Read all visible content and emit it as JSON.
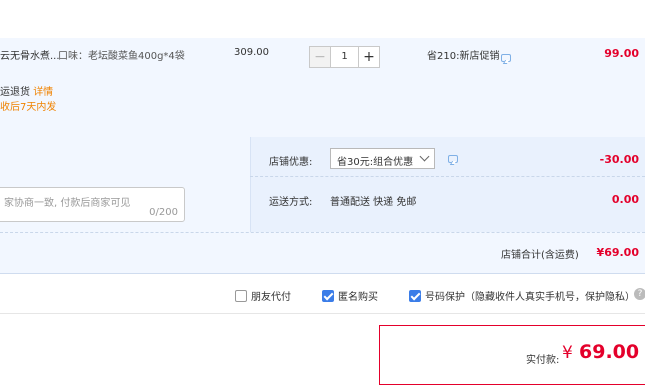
{
  "item": {
    "title": "云无骨水煮...",
    "sku": "口味：老坛酸菜鱼400g*4袋",
    "price": "309.00",
    "quantity": "1",
    "minus": "−",
    "plus": "+",
    "promo": "省210:新店促销",
    "total": "99.00",
    "service_text": "运退货",
    "service_link": "详情",
    "service_note": "收后7天内发"
  },
  "shop": {
    "message_placeholder": "家协商一致, 付款后商家可见",
    "message_count": "0/200",
    "discount_label": "店铺优惠:",
    "discount_option": "省30元:组合优惠",
    "discount_value": "-30.00",
    "shipping_label": "运送方式:",
    "shipping_value": "普通配送 快递 免邮",
    "shipping_cost": "0.00",
    "subtotal_label": "店铺合计(含运费)",
    "subtotal_value": "¥69.00"
  },
  "options": [
    {
      "label": "朋友代付",
      "checked": false
    },
    {
      "label": "匿名购买",
      "checked": true
    },
    {
      "label": "号码保护（隐藏收件人真实手机号，保护隐私）",
      "checked": true
    }
  ],
  "help": "?",
  "payment": {
    "label": "实付款:",
    "symbol": "¥",
    "amount": "69.00"
  },
  "colors": {
    "accent": "#e4002b",
    "check": "#3b7de8",
    "panel": "#f2f7ff"
  }
}
